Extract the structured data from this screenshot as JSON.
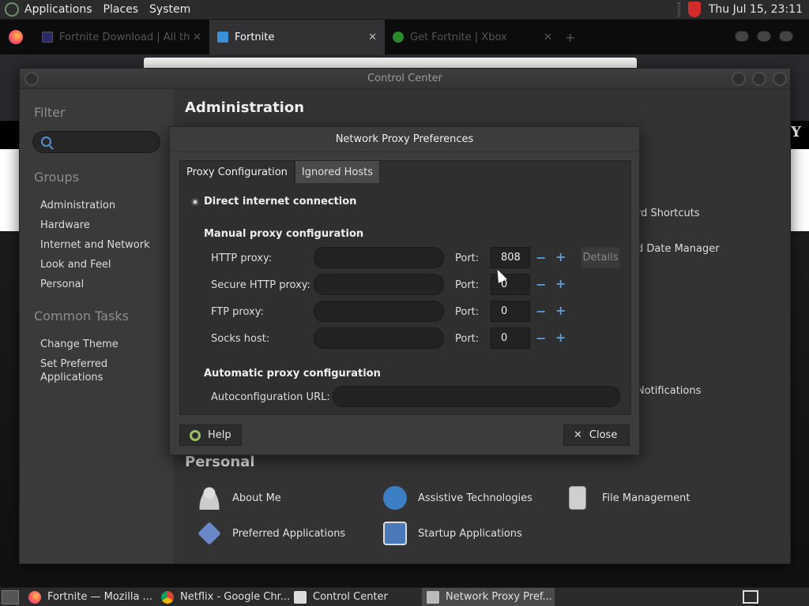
{
  "top_panel": {
    "menu": [
      "Applications",
      "Places",
      "System"
    ],
    "clock": "Thu Jul 15, 23:11"
  },
  "browser": {
    "tabs": [
      {
        "label": "Fortnite Download | All th",
        "active": false
      },
      {
        "label": "Fortnite",
        "active": true
      },
      {
        "label": "Get Fortnite | Xbox",
        "active": false
      }
    ],
    "close_glyph": "✕",
    "new_tab": "+",
    "brand_letter": "Y"
  },
  "control_center": {
    "title": "Control Center",
    "filter_heading": "Filter",
    "groups_heading": "Groups",
    "groups": [
      "Administration",
      "Hardware",
      "Internet and Network",
      "Look and Feel",
      "Personal"
    ],
    "common_tasks_heading": "Common Tasks",
    "common_tasks": [
      "Change Theme",
      "Set Preferred Applications"
    ],
    "admin_heading": "Administration",
    "behind_items": [
      "rd Shortcuts",
      "d Date Manager",
      "Notifications"
    ],
    "personal_heading": "Personal",
    "personal_items": [
      "About Me",
      "Assistive Technologies",
      "File Management",
      "Preferred Applications",
      "Startup Applications"
    ]
  },
  "dialog": {
    "title": "Network Proxy Preferences",
    "tabs": [
      "Proxy Configuration",
      "Ignored Hosts"
    ],
    "direct": "Direct internet connection",
    "manual": "Manual proxy configuration",
    "proxies": [
      {
        "label": "HTTP proxy:",
        "port_label": "Port:",
        "port": "808"
      },
      {
        "label": "Secure HTTP proxy:",
        "port_label": "Port:",
        "port": "0"
      },
      {
        "label": "FTP proxy:",
        "port_label": "Port:",
        "port": "0"
      },
      {
        "label": "Socks host:",
        "port_label": "Port:",
        "port": "0"
      }
    ],
    "minus": "−",
    "plus": "+",
    "details": "Details",
    "automatic": "Automatic proxy configuration",
    "autoconf_label": "Autoconfiguration URL:",
    "help": "Help",
    "close": "Close",
    "close_glyph": "✕"
  },
  "taskbar": {
    "items": [
      {
        "label": "Fortnite — Mozilla ...",
        "active": false
      },
      {
        "label": "Netflix - Google Chr...",
        "active": false
      },
      {
        "label": "Control Center",
        "active": false
      },
      {
        "label": "Network Proxy Pref...",
        "active": true
      }
    ]
  }
}
